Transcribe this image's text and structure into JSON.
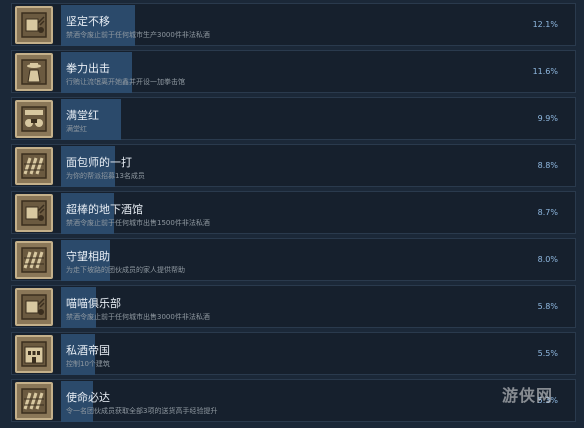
{
  "achievements": [
    {
      "title": "坚定不移",
      "desc": "禁酒令废止前于任何城市生产3000件非法私酒",
      "percent": "12.1%",
      "percent_value": 12.1,
      "icon": "package-crate-icon"
    },
    {
      "title": "拳力出击",
      "desc": "行贿让流氓离开她鑫并开设一加拳击馆",
      "percent": "11.6%",
      "percent_value": 11.6,
      "icon": "boxer-figure-icon"
    },
    {
      "title": "满堂红",
      "desc": "满堂红",
      "percent": "9.9%",
      "percent_value": 9.9,
      "icon": "full-house-icon"
    },
    {
      "title": "面包师的一打",
      "desc": "为你的帮派招募13名成员",
      "percent": "8.8%",
      "percent_value": 8.8,
      "icon": "bottles-rack-icon"
    },
    {
      "title": "超棒的地下酒馆",
      "desc": "禁酒令废止前于任何城市出售1500件非法私酒",
      "percent": "8.7%",
      "percent_value": 8.7,
      "icon": "package-crate-icon"
    },
    {
      "title": "守望相助",
      "desc": "为走下坡路的团伙成员的家人提供帮助",
      "percent": "8.0%",
      "percent_value": 8.0,
      "icon": "bottles-rack-icon"
    },
    {
      "title": "喵喵俱乐部",
      "desc": "禁酒令废止前于任何城市出售3000件非法私酒",
      "percent": "5.8%",
      "percent_value": 5.8,
      "icon": "package-crate-icon"
    },
    {
      "title": "私酒帝国",
      "desc": "控制10个建筑",
      "percent": "5.5%",
      "percent_value": 5.5,
      "icon": "building-icon"
    },
    {
      "title": "使命必达",
      "desc": "令一名团伙成员获取全部3项的送货高手经验提升",
      "percent": "5.3%",
      "percent_value": 5.3,
      "icon": "bottles-rack-icon"
    }
  ],
  "watermark": "游侠网",
  "colors": {
    "background": "#1b2838",
    "row": "#16202d",
    "bar": "#2b4a6b",
    "percent": "#8fb8e0"
  }
}
